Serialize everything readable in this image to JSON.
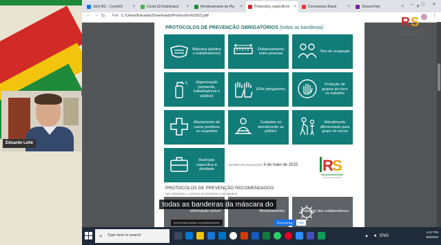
{
  "browser": {
    "tabs": [
      {
        "title": "SES-RS :: Covid19",
        "color": "#1a73e8"
      },
      {
        "title": "Covid-19 Dashboard",
        "color": "#4caf50"
      },
      {
        "title": "Monitoramento do Pla",
        "color": "#1e8a3a"
      },
      {
        "title": "Protocolos_especificos",
        "color": "#d22a26",
        "active": true
      },
      {
        "title": "Coronavirus Brasil",
        "color": "#e53935"
      },
      {
        "title": "StreamYard",
        "color": "#7b1fa2"
      }
    ],
    "new_tab": "+",
    "address_label": "File",
    "address": "C:/Users/Eduardo/Downloads/Protocolos%20(2).pdf"
  },
  "pdf": {
    "section_title": "PROTOCOLOS DE PREVENÇÃO OBRIGATÓRIOS",
    "section_sub": "(todas as bandeiras)",
    "cards": [
      {
        "label": "Máscara (público e trabalhadores)",
        "icon": "mask-icon"
      },
      {
        "label": "Distanciamento entre pessoas",
        "icon": "ruler-icon"
      },
      {
        "label": "Teto de ocupação",
        "icon": "people-icon"
      },
      {
        "label": "Higienização (ambiente, trabalhadores e público)",
        "icon": "spray-bottle-icon"
      },
      {
        "label": "EPIs obrigatórios",
        "icon": "gloves-icon"
      },
      {
        "label": "Proteção de grupos de risco no trabalho",
        "icon": "hand-stop-icon"
      },
      {
        "label": "Afastamento de casos positivos ou suspeitos",
        "icon": "cross-icon"
      },
      {
        "label": "Cuidados no atendimento ao público",
        "icon": "service-icon"
      },
      {
        "label": "Atendimento diferenciado para grupo de riscos",
        "icon": "elderly-icon"
      },
      {
        "label": "Restrição específica à atividade",
        "icon": "briefcase-icon"
      }
    ],
    "updated_label": "ÚLTIMA ATUALIZAÇÃO:",
    "updated_date": "9 de maio de 2020",
    "recommended_title": "PROTOCOLOS DE PREVENÇÃO RECOMENDADOS",
    "recommended_sub": "(por atividades, conforme as bandeiras e atividades)",
    "grey_cards": [
      {
        "label": "Informação visível"
      },
      {
        "label": "Monitoramento"
      },
      {
        "label": "Testagem dos colaboradores"
      }
    ]
  },
  "video": {
    "name": "Eduardo Leite"
  },
  "caption": "todas as bandeiras da máscara do",
  "sharing": {
    "text": "Interromper/ocultar compartilhamento",
    "stop": "Stop sharing",
    "hide": "Hide"
  },
  "taskbar": {
    "search_placeholder": "Type here to search",
    "time": "5:47 PM",
    "date": "5/9/2020",
    "lang": "ENG"
  },
  "brand": {
    "r": "R",
    "s": "S",
    "tagline": "GOVERNO DO ESTADO RIO GRANDE DO SUL"
  }
}
